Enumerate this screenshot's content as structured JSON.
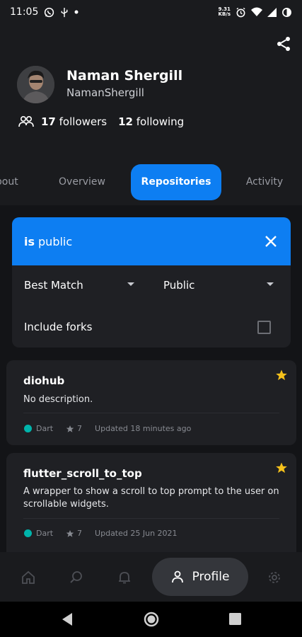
{
  "status_bar": {
    "time": "11:05",
    "net_speed_value": "9.31",
    "net_speed_unit": "KB/s",
    "icons": [
      "whatsapp-icon",
      "usb-icon",
      "dot-icon",
      "alarm-icon",
      "wifi-icon",
      "signal-icon",
      "battery-icon"
    ]
  },
  "profile": {
    "display_name": "Naman Shergill",
    "username": "NamanShergill",
    "followers_count": "17",
    "followers_label": "followers",
    "following_count": "12",
    "following_label": "following"
  },
  "tabs": [
    {
      "label": "About"
    },
    {
      "label": "Overview"
    },
    {
      "label": "Repositories"
    },
    {
      "label": "Activity"
    }
  ],
  "active_tab": "Repositories",
  "filter": {
    "query_keyword": "is",
    "query_value": "public",
    "sort_selected": "Best Match",
    "visibility_selected": "Public",
    "include_forks_label": "Include forks",
    "include_forks_checked": false
  },
  "repos": [
    {
      "name": "diohub",
      "description": "No description.",
      "language": "Dart",
      "language_color": "#00b4ab",
      "stars": "7",
      "updated": "Updated 18 minutes ago",
      "starred": true
    },
    {
      "name": "flutter_scroll_to_top",
      "description": "A wrapper to show a scroll to top prompt to the user on scrollable widgets.",
      "language": "Dart",
      "language_color": "#00b4ab",
      "stars": "7",
      "updated": "Updated 25 Jun 2021",
      "starred": true
    }
  ],
  "bottom_nav": {
    "items": [
      "home-icon",
      "search-icon",
      "bell-icon",
      "profile",
      "settings-icon"
    ],
    "active_label": "Profile"
  },
  "colors": {
    "accent": "#0d7ef2",
    "star": "#f5c11b",
    "background": "#1a1b1e",
    "card": "#1f2024"
  }
}
